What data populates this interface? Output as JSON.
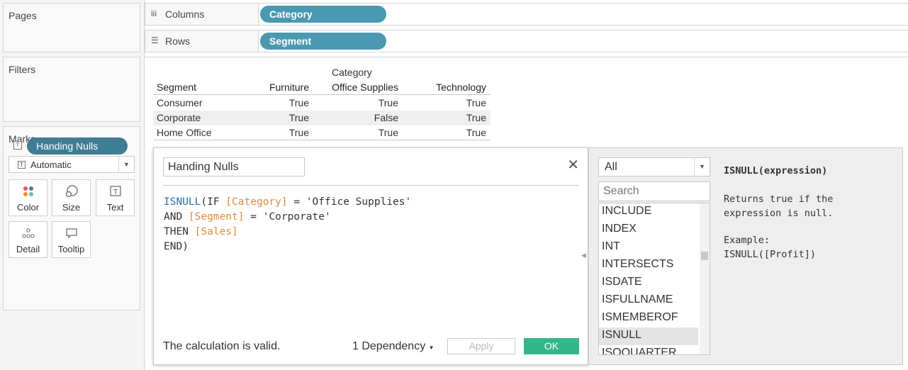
{
  "sidebar": {
    "pages_title": "Pages",
    "filters_title": "Filters",
    "marks_title": "Marks",
    "mark_type": "Automatic",
    "mark_buttons": [
      {
        "label": "Color",
        "icon": "color-dots-icon"
      },
      {
        "label": "Size",
        "icon": "size-icon"
      },
      {
        "label": "Text",
        "icon": "text-icon"
      },
      {
        "label": "Detail",
        "icon": "detail-icon"
      },
      {
        "label": "Tooltip",
        "icon": "tooltip-icon"
      }
    ],
    "mark_pill": "Handing Nulls"
  },
  "shelves": {
    "columns_label": "Columns",
    "columns_pill": "Category",
    "rows_label": "Rows",
    "rows_pill": "Segment",
    "pill_color": "#4a99b0"
  },
  "table": {
    "column_group_header": "Category",
    "row_header": "Segment",
    "columns": [
      "Furniture",
      "Office Supplies",
      "Technology"
    ],
    "rows": [
      {
        "segment": "Consumer",
        "values": [
          "True",
          "True",
          "True"
        ]
      },
      {
        "segment": "Corporate",
        "values": [
          "True",
          "False",
          "True"
        ]
      },
      {
        "segment": "Home Office",
        "values": [
          "True",
          "True",
          "True"
        ]
      }
    ]
  },
  "calc_editor": {
    "name": "Handing Nulls",
    "code_lines": [
      {
        "parts": [
          {
            "t": "ISNULL",
            "k": "fn"
          },
          {
            "t": "(IF ",
            "k": "plain"
          },
          {
            "t": "[Category]",
            "k": "fld"
          },
          {
            "t": " = ",
            "k": "plain"
          },
          {
            "t": "'Office Supplies'",
            "k": "str"
          }
        ]
      },
      {
        "parts": [
          {
            "t": "AND ",
            "k": "plain"
          },
          {
            "t": "[Segment]",
            "k": "fld"
          },
          {
            "t": " = ",
            "k": "plain"
          },
          {
            "t": "'Corporate'",
            "k": "str"
          }
        ]
      },
      {
        "parts": [
          {
            "t": "THEN ",
            "k": "plain"
          },
          {
            "t": "[Sales]",
            "k": "fld"
          }
        ]
      },
      {
        "parts": [
          {
            "t": "END)",
            "k": "plain"
          }
        ]
      }
    ],
    "status": "The calculation is valid.",
    "dependency": "1 Dependency",
    "apply_label": "Apply",
    "ok_label": "OK",
    "ok_color": "#35b68a"
  },
  "function_panel": {
    "category": "All",
    "search_placeholder": "Search",
    "functions": [
      "INCLUDE",
      "INDEX",
      "INT",
      "INTERSECTS",
      "ISDATE",
      "ISFULLNAME",
      "ISMEMBEROF",
      "ISNULL",
      "ISOQUARTER"
    ],
    "selected": "ISNULL",
    "signature": "ISNULL(expression)",
    "description": "Returns true if the expression is null.",
    "example_heading": "Example:",
    "example_code": "ISNULL([Profit])"
  }
}
